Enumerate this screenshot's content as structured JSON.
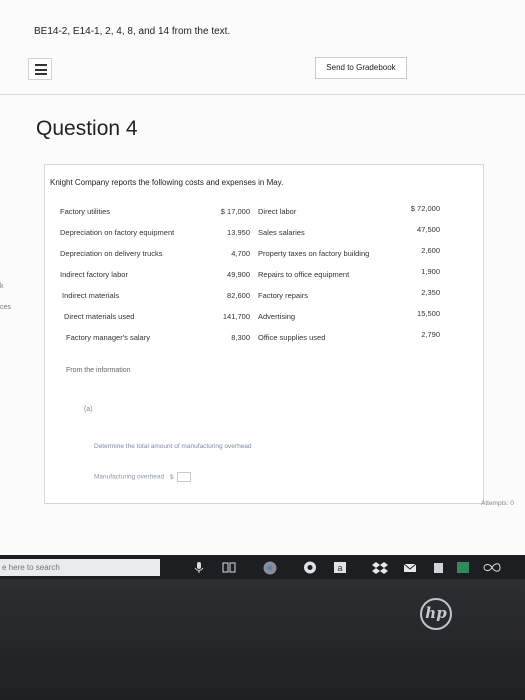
{
  "header": {
    "assignment_title": "BE14-2, E14-1, 2, 4, 8, and 14 from the text."
  },
  "toolbar": {
    "send_label": "Send to Gradebook"
  },
  "question": {
    "title": "Question 4",
    "intro": "Knight Company reports the following costs and expenses in May.",
    "left_items": [
      {
        "label": "Factory utilities",
        "value": "$ 17,000"
      },
      {
        "label": "Depreciation on factory equipment",
        "value": "13,950"
      },
      {
        "label": "Depreciation on delivery trucks",
        "value": "4,700"
      },
      {
        "label": "Indirect factory labor",
        "value": "49,900"
      },
      {
        "label": "Indirect materials",
        "value": "82,600"
      },
      {
        "label": "Direct materials used",
        "value": "141,700"
      },
      {
        "label": "Factory manager's salary",
        "value": "8,300"
      }
    ],
    "right_items": [
      {
        "label": "Direct labor",
        "value": "$ 72,000"
      },
      {
        "label": "Sales salaries",
        "value": "47,500"
      },
      {
        "label": "Property taxes on factory building",
        "value": "2,600"
      },
      {
        "label": "Repairs to office equipment",
        "value": "1,900"
      },
      {
        "label": "Factory repairs",
        "value": "2,350"
      },
      {
        "label": "Advertising",
        "value": "15,500"
      },
      {
        "label": "Office supplies used",
        "value": "2,790"
      }
    ],
    "from_info": "From the information",
    "part_a": "(a)",
    "determine": "Determine the total amount of manufacturing overhead",
    "mo_label": "Manufacturing overhead",
    "mo_prefix": "$"
  },
  "attempts": "Attempts: 0",
  "left_edge": {
    "k": "k",
    "ces": "ces"
  },
  "taskbar": {
    "search_placeholder": "e here to search"
  },
  "colors": {
    "accent": "#8a96a8",
    "taskbar": "#1c1e22"
  }
}
